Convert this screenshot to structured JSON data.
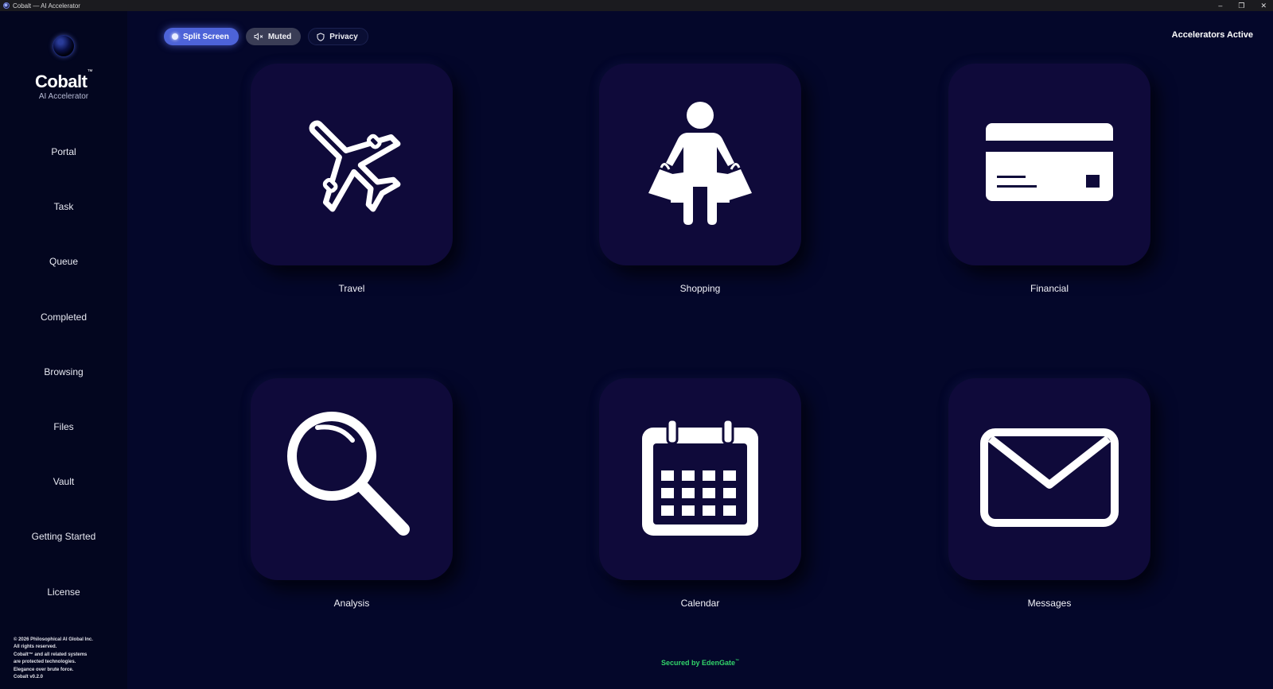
{
  "window": {
    "title": "Cobalt — AI Accelerator",
    "controls": {
      "minimize": "–",
      "restore": "❐",
      "close": "✕"
    }
  },
  "sidebar": {
    "brand": "Cobalt",
    "brand_mark": "™",
    "subtitle": "AI Accelerator",
    "items": [
      {
        "label": "Portal"
      },
      {
        "label": "Task"
      },
      {
        "label": "Queue"
      },
      {
        "label": "Completed"
      },
      {
        "label": "Browsing"
      },
      {
        "label": "Files"
      },
      {
        "label": "Vault"
      },
      {
        "label": "Getting Started"
      },
      {
        "label": "License"
      }
    ],
    "copyright_lines": [
      "© 2026 Philosophical AI Global Inc.",
      "All rights reserved.",
      "Cobalt™ and all related systems",
      "are protected technologies.",
      "Elegance over brute force.",
      "Cobalt v0.2.0"
    ]
  },
  "toolbar": {
    "split_label": "Split Screen",
    "muted_label": "Muted",
    "privacy_label": "Privacy"
  },
  "status": {
    "text": "Accelerators Active"
  },
  "tiles": [
    {
      "label": "Travel",
      "icon": "airplane-icon"
    },
    {
      "label": "Shopping",
      "icon": "shopper-with-bags-icon"
    },
    {
      "label": "Financial",
      "icon": "credit-card-icon"
    },
    {
      "label": "Analysis",
      "icon": "magnifying-glass-icon"
    },
    {
      "label": "Calendar",
      "icon": "calendar-icon"
    },
    {
      "label": "Messages",
      "icon": "envelope-icon"
    }
  ],
  "footer": {
    "secured_text": "Secured by EdenGate",
    "secured_mark": "™"
  },
  "colors": {
    "background": "#04072a",
    "sidebar": "#03061f",
    "tile": "#0f0a3a",
    "accent": "#4d63d8",
    "secured_green": "#32d46a"
  }
}
